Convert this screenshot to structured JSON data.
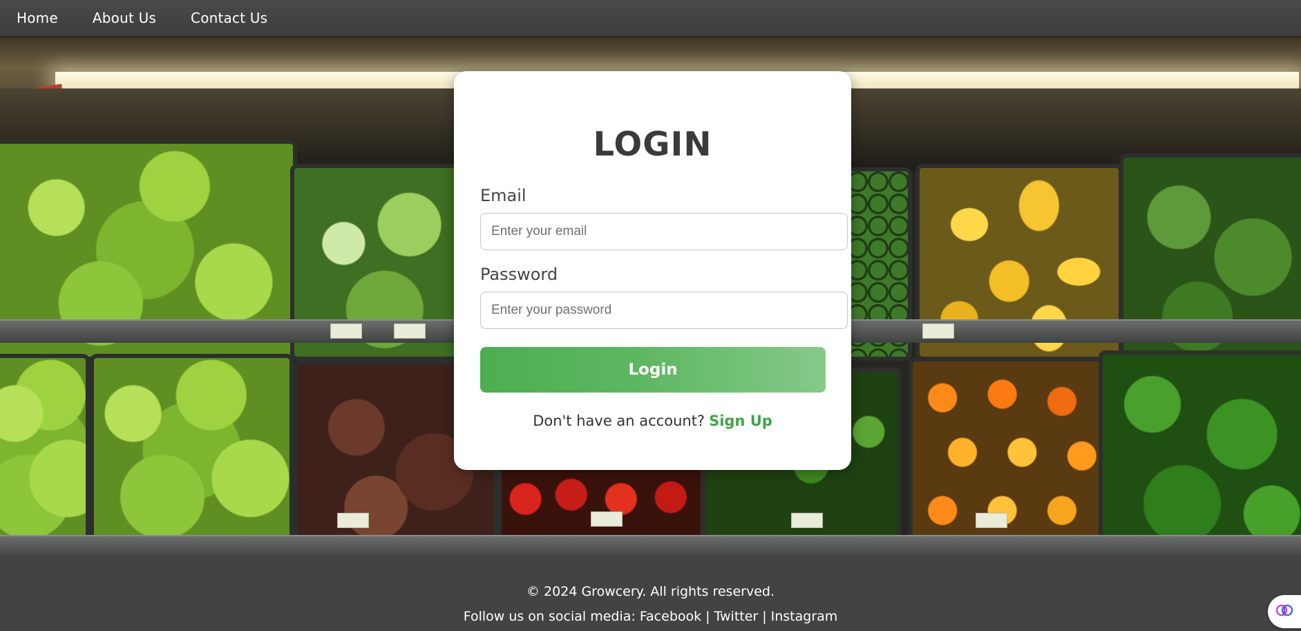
{
  "nav": {
    "items": [
      {
        "label": "Home"
      },
      {
        "label": "About Us"
      },
      {
        "label": "Contact Us"
      }
    ]
  },
  "login": {
    "title": "LOGIN",
    "email_label": "Email",
    "email_placeholder": "Enter your email",
    "email_value": "",
    "password_label": "Password",
    "password_placeholder": "Enter your password",
    "password_value": "",
    "button_label": "Login",
    "signup_prompt": "Don't have an account?",
    "signup_link": "Sign Up"
  },
  "footer": {
    "copyright": "© 2024 Growcery. All rights reserved.",
    "social_prefix": "Follow us on social media:",
    "links": [
      "Facebook",
      "Twitter",
      "Instagram"
    ],
    "separator": "|"
  },
  "colors": {
    "accent": "#4caf50",
    "nav_bg": "#444444",
    "footer_bg": "#434343",
    "title_text": "#3b3b3b"
  },
  "icons": {
    "floating_widget": "brain-icon"
  }
}
